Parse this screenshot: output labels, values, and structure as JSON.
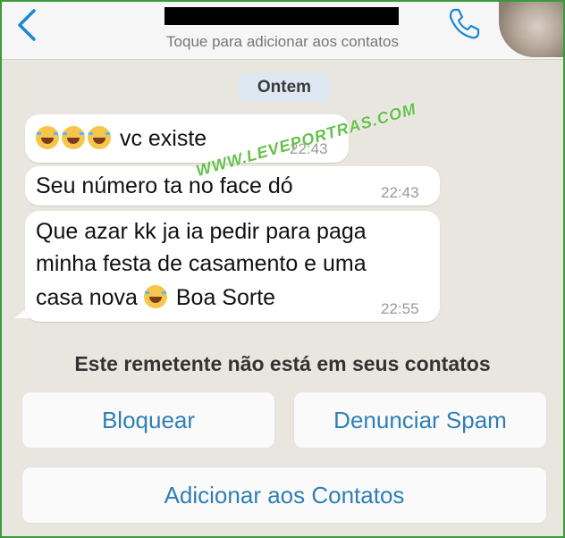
{
  "header": {
    "subtitle": "Toque para adicionar aos contatos",
    "back_icon": "chevron-left-icon",
    "call_icon": "phone-icon",
    "accent_color": "#1a87d4"
  },
  "chat": {
    "day_label": "Ontem",
    "messages": [
      {
        "text": "vc existe",
        "time": "22:43",
        "emoji_count": 3
      },
      {
        "text": "Seu número ta no face dó",
        "time": "22:43"
      },
      {
        "lines": [
          "Que azar kk ja ia pedir para paga",
          "minha festa de casamento e uma"
        ],
        "text_before_emoji": "casa nova",
        "text_after_emoji": "Boa Sorte",
        "time": "22:55"
      }
    ]
  },
  "watermark": "WWW.LEVEPORTRAS.COM",
  "notice": {
    "text": "Este remetente não está em seus contatos",
    "block_label": "Bloquear",
    "spam_label": "Denunciar Spam",
    "add_label": "Adicionar aos Contatos"
  }
}
